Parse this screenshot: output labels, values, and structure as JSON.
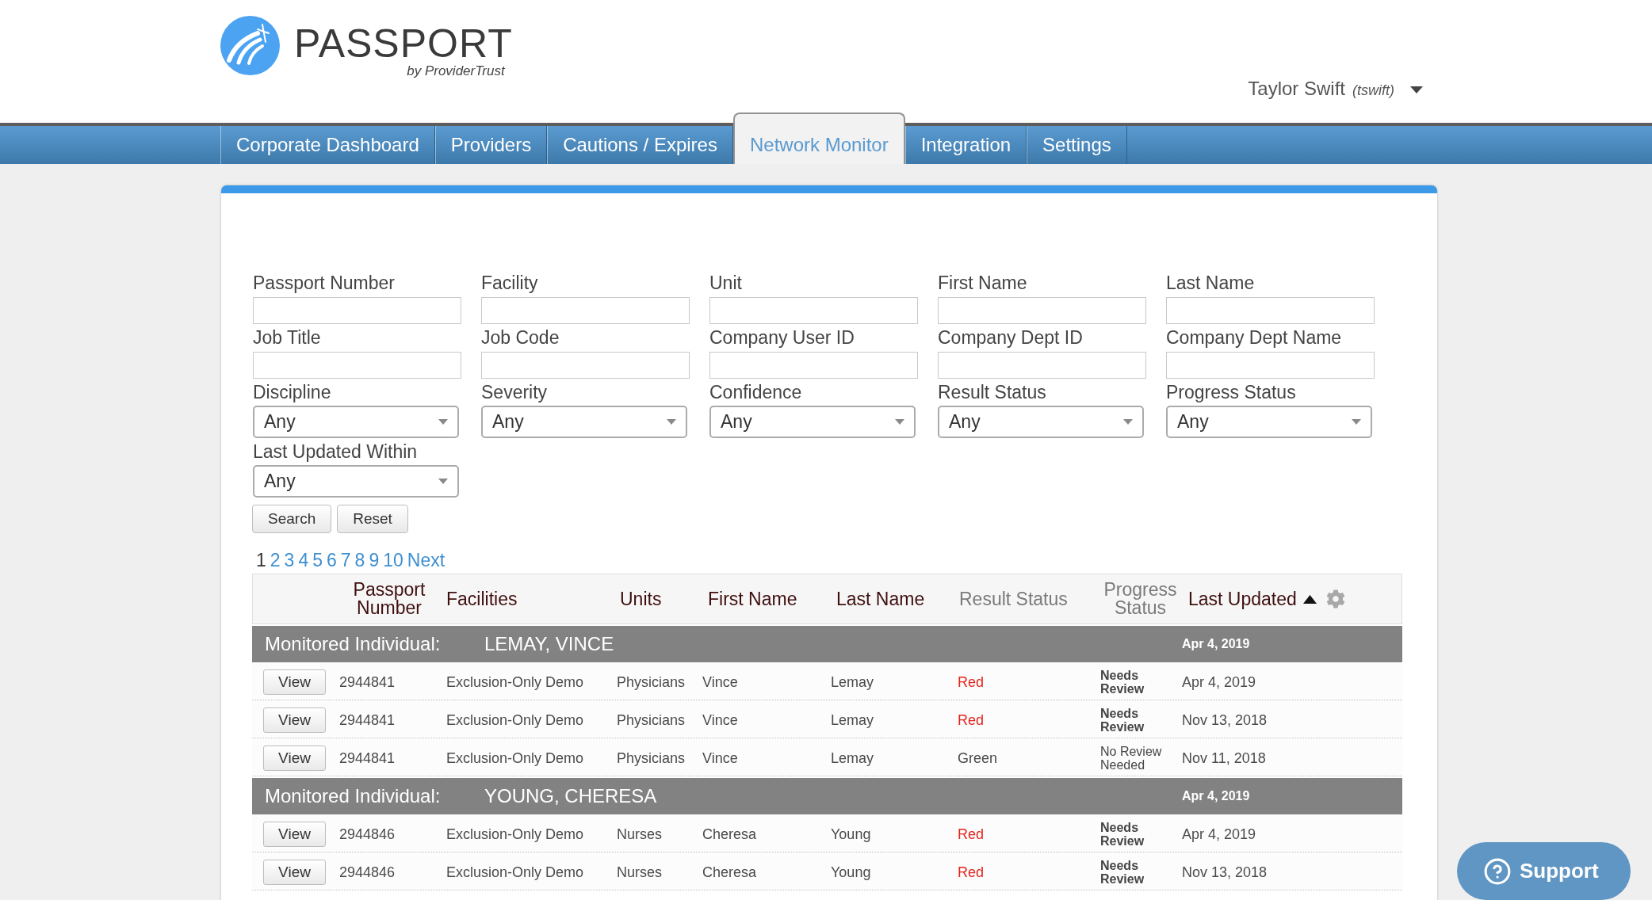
{
  "header": {
    "logo": {
      "wordmark": "PASSPORT",
      "byline": "by ProviderTrust"
    },
    "user": {
      "name": "Taylor Swift",
      "username": "(tswift)"
    }
  },
  "nav": {
    "tabs": [
      {
        "label": "Corporate Dashboard",
        "selected": false
      },
      {
        "label": "Providers",
        "selected": false
      },
      {
        "label": "Cautions / Expires",
        "selected": false
      },
      {
        "label": "Network Monitor",
        "selected": true
      },
      {
        "label": "Integration",
        "selected": false
      },
      {
        "label": "Settings",
        "selected": false
      }
    ]
  },
  "filters": {
    "fields": [
      {
        "label": "Passport Number",
        "kind": "text"
      },
      {
        "label": "Facility",
        "kind": "text"
      },
      {
        "label": "Unit",
        "kind": "text"
      },
      {
        "label": "First Name",
        "kind": "text"
      },
      {
        "label": "Last Name",
        "kind": "text"
      },
      {
        "label": "Job Title",
        "kind": "text"
      },
      {
        "label": "Job Code",
        "kind": "text"
      },
      {
        "label": "Company User ID",
        "kind": "text"
      },
      {
        "label": "Company Dept ID",
        "kind": "text"
      },
      {
        "label": "Company Dept Name",
        "kind": "text"
      },
      {
        "label": "Discipline",
        "kind": "select",
        "value": "Any"
      },
      {
        "label": "Severity",
        "kind": "select",
        "value": "Any"
      },
      {
        "label": "Confidence",
        "kind": "select",
        "value": "Any"
      },
      {
        "label": "Result Status",
        "kind": "select",
        "value": "Any"
      },
      {
        "label": "Progress Status",
        "kind": "select",
        "value": "Any"
      },
      {
        "label": "Last Updated Within",
        "kind": "select",
        "value": "Any"
      }
    ],
    "buttons": [
      "Search",
      "Reset"
    ]
  },
  "pagination": {
    "pages": [
      {
        "label": "1",
        "selected": true
      },
      {
        "label": "2",
        "selected": false
      },
      {
        "label": "3",
        "selected": false
      },
      {
        "label": "4",
        "selected": false
      },
      {
        "label": "5",
        "selected": false
      },
      {
        "label": "6",
        "selected": false
      },
      {
        "label": "7",
        "selected": false
      },
      {
        "label": "8",
        "selected": false
      },
      {
        "label": "9",
        "selected": false
      },
      {
        "label": "10",
        "selected": false
      }
    ],
    "next": "Next"
  },
  "table": {
    "columns": [
      {
        "label": "Passport Number",
        "sortable": true,
        "sorted": false
      },
      {
        "label": "Facilities",
        "sortable": true,
        "sorted": false
      },
      {
        "label": "Units",
        "sortable": true,
        "sorted": false
      },
      {
        "label": "First Name",
        "sortable": true,
        "sorted": false
      },
      {
        "label": "Last Name",
        "sortable": true,
        "sorted": false
      },
      {
        "label": "Result Status",
        "sortable": false,
        "sorted": false
      },
      {
        "label": "Progress Status",
        "sortable": false,
        "sorted": false
      },
      {
        "label": "Last Updated",
        "sortable": true,
        "sorted": true
      }
    ],
    "groups": [
      {
        "label": "Monitored Individual:",
        "name": "LEMAY, VINCE",
        "date": "Apr 4, 2019",
        "rows": [
          {
            "action": "View",
            "passport_number": "2944841",
            "facility": "Exclusion-Only Demo",
            "unit": "Physicians",
            "first_name": "Vince",
            "last_name": "Lemay",
            "result_status": "Red",
            "color": "#e3261f",
            "progress_status": "Needs Review",
            "flagged": true,
            "last_updated": "Apr 4, 2019"
          },
          {
            "action": "View",
            "passport_number": "2944841",
            "facility": "Exclusion-Only Demo",
            "unit": "Physicians",
            "first_name": "Vince",
            "last_name": "Lemay",
            "result_status": "Red",
            "color": "#e3261f",
            "progress_status": "Needs Review",
            "flagged": true,
            "last_updated": "Nov 13, 2018"
          },
          {
            "action": "View",
            "passport_number": "2944841",
            "facility": "Exclusion-Only Demo",
            "unit": "Physicians",
            "first_name": "Vince",
            "last_name": "Lemay",
            "result_status": "Green",
            "color": "#4a4a4a",
            "progress_status": "No Review Needed",
            "flagged": false,
            "last_updated": "Nov 11, 2018"
          }
        ]
      },
      {
        "label": "Monitored Individual:",
        "name": "YOUNG, CHERESA",
        "date": "Apr 4, 2019",
        "rows": [
          {
            "action": "View",
            "passport_number": "2944846",
            "facility": "Exclusion-Only Demo",
            "unit": "Nurses",
            "first_name": "Cheresa",
            "last_name": "Young",
            "result_status": "Red",
            "color": "#e3261f",
            "progress_status": "Needs Review",
            "flagged": true,
            "last_updated": "Apr 4, 2019"
          },
          {
            "action": "View",
            "passport_number": "2944846",
            "facility": "Exclusion-Only Demo",
            "unit": "Nurses",
            "first_name": "Cheresa",
            "last_name": "Young",
            "result_status": "Red",
            "color": "#e3261f",
            "progress_status": "Needs Review",
            "flagged": true,
            "last_updated": "Nov 13, 2018"
          }
        ]
      }
    ]
  },
  "support": {
    "label": "Support"
  }
}
